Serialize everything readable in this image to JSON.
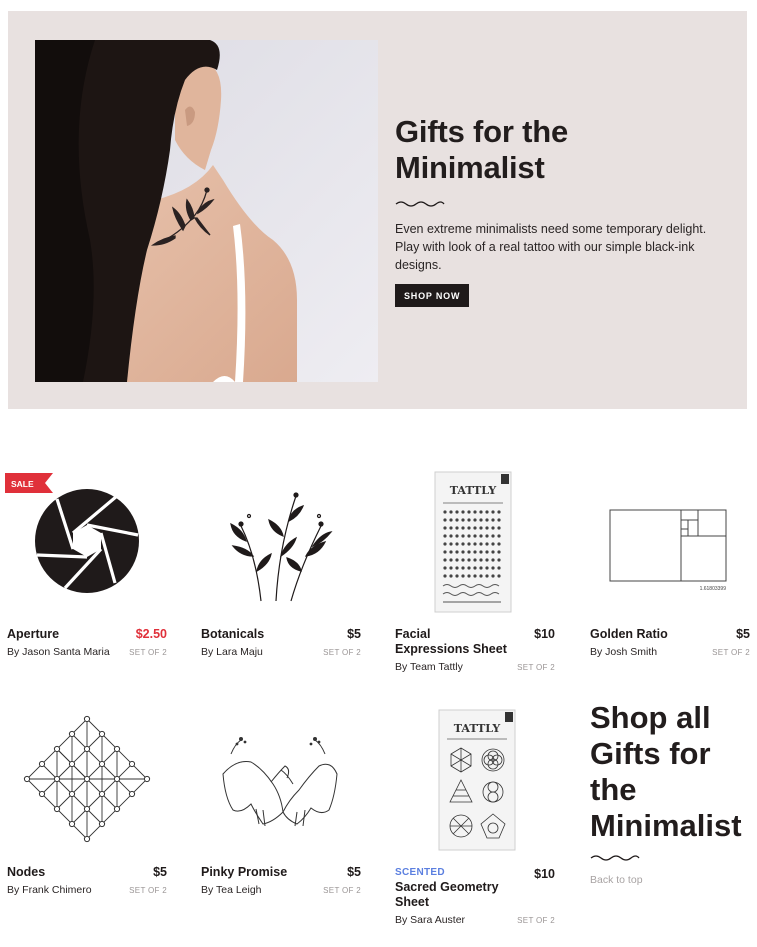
{
  "hero": {
    "title_line1": "Gifts for the",
    "title_line2": "Minimalist",
    "description": "Even extreme minimalists need some temporary delight. Play with look of a real tattoo with our simple black-ink designs.",
    "button_label": "SHOP NOW",
    "background_color": "#e8e1e0"
  },
  "products": [
    {
      "name": "Aperture",
      "price": "$2.50",
      "author": "By Jason Santa Maria",
      "set": "SET OF 2",
      "badge": "SALE",
      "sale": true
    },
    {
      "name": "Botanicals",
      "price": "$5",
      "author": "By Lara Maju",
      "set": "SET OF 2"
    },
    {
      "name": "Facial Expressions Sheet",
      "price": "$10",
      "author": "By Team Tattly",
      "set": "SET OF 2",
      "package_brand": "TATTLY"
    },
    {
      "name": "Golden Ratio",
      "price": "$5",
      "author": "By Josh Smith",
      "set": "SET OF 2",
      "image_caption": "1.61803399"
    },
    {
      "name": "Nodes",
      "price": "$5",
      "author": "By Frank Chimero",
      "set": "SET OF 2"
    },
    {
      "name": "Pinky Promise",
      "price": "$5",
      "author": "By Tea Leigh",
      "set": "SET OF 2"
    },
    {
      "name": "Sacred Geometry Sheet",
      "price": "$10",
      "author": "By Sara Auster",
      "set": "SET OF 2",
      "tag": "SCENTED",
      "package_brand": "TATTLY"
    }
  ],
  "shop_all": {
    "line1": "Shop all",
    "line2": "Gifts for",
    "line3": "the",
    "line4": "Minimalist",
    "back_to_top": "Back to top"
  },
  "colors": {
    "sale_red": "#e0303a",
    "scented_blue": "#5b7fe0",
    "dark": "#1f1a1a"
  }
}
